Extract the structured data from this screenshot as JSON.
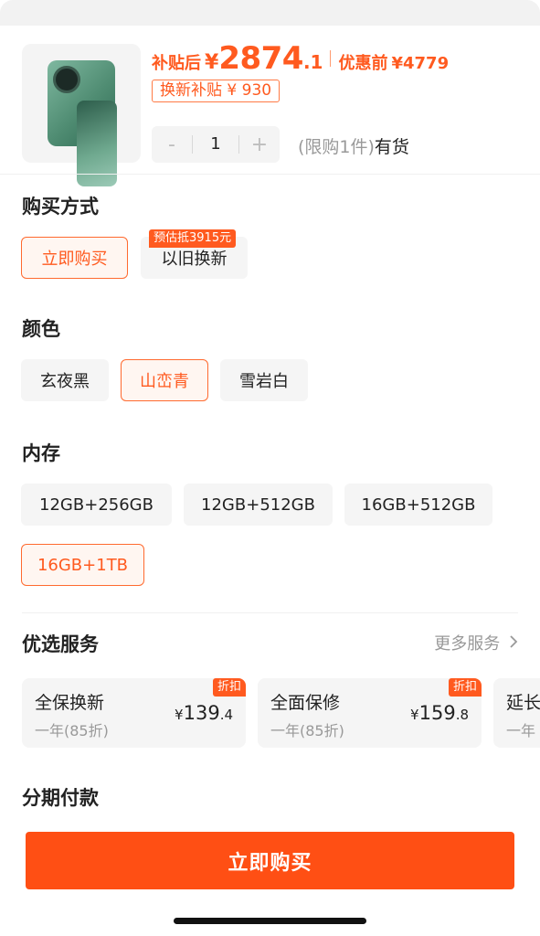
{
  "product": {
    "price_after_label": "补贴后",
    "currency": "¥",
    "price_after_int": "2874",
    "price_after_dec": ".1",
    "price_before_label": "优惠前",
    "price_before": "¥4779",
    "subsidy_tag": "换新补贴 ¥ 930",
    "quantity": "1",
    "minus": "-",
    "plus": "+",
    "limit_text": "(限购1件)",
    "stock_text": "有货"
  },
  "purchase": {
    "title": "购买方式",
    "options": [
      "立即购买",
      "以旧换新"
    ],
    "selected": 0,
    "trade_in_badge": "预估抵3915元"
  },
  "color": {
    "title": "颜色",
    "options": [
      "玄夜黑",
      "山峦青",
      "雪岩白"
    ],
    "selected": 1
  },
  "memory": {
    "title": "内存",
    "options": [
      "12GB+256GB",
      "12GB+512GB",
      "16GB+512GB",
      "16GB+1TB"
    ],
    "selected": 3
  },
  "services": {
    "title": "优选服务",
    "more": "更多服务",
    "items": [
      {
        "name": "全保换新",
        "sub": "一年(85折)",
        "yen": "¥",
        "int": "139",
        "dec": ".4",
        "tag": "折扣"
      },
      {
        "name": "全面保修",
        "sub": "一年(85折)",
        "yen": "¥",
        "int": "159",
        "dec": ".8",
        "tag": "折扣"
      },
      {
        "name": "延长",
        "sub": "一年"
      }
    ]
  },
  "installment": {
    "title": "分期付款"
  },
  "cta": {
    "buy": "立即购买"
  },
  "colors": {
    "accent": "#ff5a1f",
    "button": "#ff4f14",
    "chip_bg": "#f5f5f5"
  }
}
